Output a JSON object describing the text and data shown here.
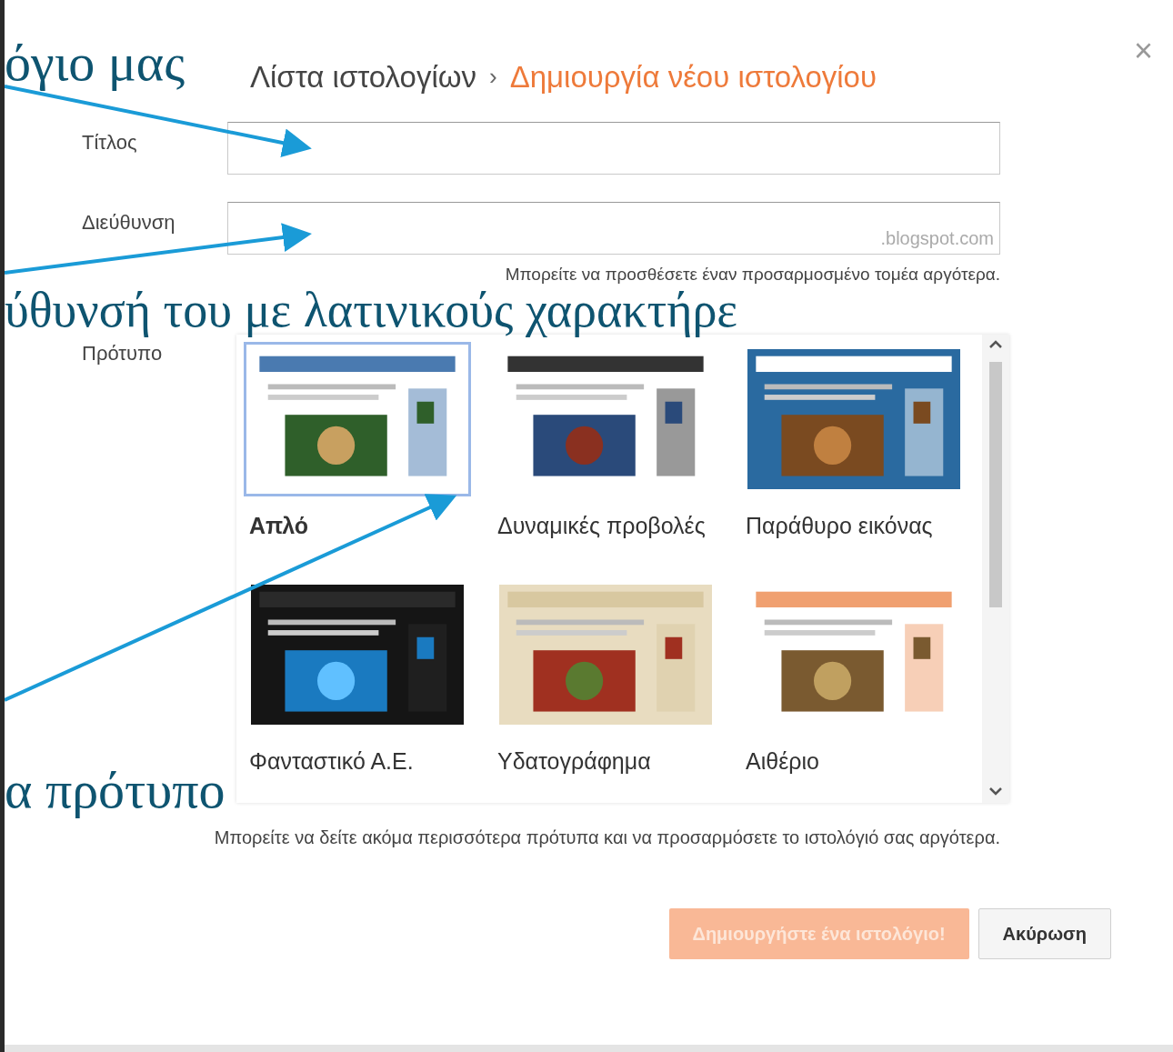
{
  "annotations": [
    {
      "text": "όγιο μας"
    },
    {
      "text": "ύθυνσή του με λατινικούς χαρακτήρε"
    },
    {
      "text": "α πρότυπο"
    }
  ],
  "breadcrumb": {
    "parent": "Λίστα ιστολογίων",
    "separator": "›",
    "current": "Δημιουργία νέου ιστολογίου"
  },
  "close": "×",
  "fields": [
    {
      "label": "Τίτλος"
    },
    {
      "label": "Διεύθυνση",
      "suffix": ".blogspot.com",
      "hint": "Μπορείτε να προσθέσετε έναν προσαρμοσμένο τομέα αργότερα."
    }
  ],
  "template_label": "Πρότυπο",
  "templates": [
    {
      "name": "Απλό",
      "selected": true
    },
    {
      "name": "Δυναμικές προβολές",
      "selected": false
    },
    {
      "name": "Παράθυρο εικόνας",
      "selected": false
    },
    {
      "name": "Φανταστικό Α.Ε.",
      "selected": false
    },
    {
      "name": "Υδατογράφημα",
      "selected": false
    },
    {
      "name": "Αιθέριο",
      "selected": false
    }
  ],
  "note": "Μπορείτε να δείτε ακόμα περισσότερα πρότυπα και να προσαρμόσετε το ιστολόγιό σας αργότερα.",
  "buttons": [
    {
      "label": "Δημιουργήστε ένα ιστολόγιο!",
      "disabled": true
    },
    {
      "label": "Ακύρωση",
      "disabled": false
    }
  ]
}
